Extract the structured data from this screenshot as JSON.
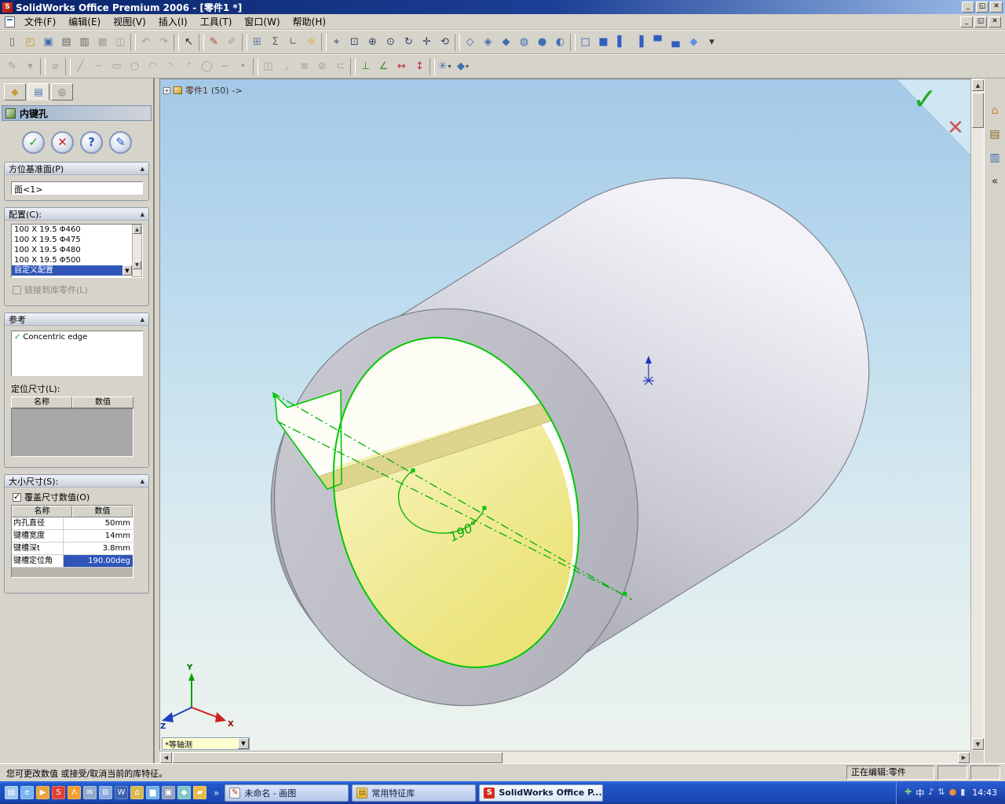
{
  "window": {
    "title": "SolidWorks Office Premium 2006 - [零件1 *]"
  },
  "titlebar_buttons": [
    {
      "name": "minimize-button",
      "glyph": "_"
    },
    {
      "name": "restore-button",
      "glyph": "◱"
    },
    {
      "name": "close-button",
      "glyph": "✕"
    }
  ],
  "menu": {
    "items": [
      "文件(F)",
      "编辑(E)",
      "视图(V)",
      "插入(I)",
      "工具(T)",
      "窗口(W)",
      "帮助(H)"
    ],
    "mdi_buttons": [
      {
        "name": "mdi-minimize-button",
        "glyph": "_"
      },
      {
        "name": "mdi-restore-button",
        "glyph": "◱"
      },
      {
        "name": "mdi-close-button",
        "glyph": "✕"
      }
    ]
  },
  "toolbars": {
    "main": [
      {
        "name": "new-button",
        "glyph": "▯",
        "color": "#666666",
        "enabled": true
      },
      {
        "name": "open-button",
        "glyph": "◰",
        "color": "#c79a2e",
        "enabled": true
      },
      {
        "name": "save-button",
        "glyph": "▣",
        "color": "#3f6fb0",
        "enabled": true
      },
      {
        "name": "make-drawing-button",
        "glyph": "▤",
        "color": "#666666",
        "enabled": true
      },
      {
        "name": "make-assembly-button",
        "glyph": "▥",
        "color": "#666666",
        "enabled": true
      },
      {
        "name": "print-button",
        "glyph": "▦",
        "color": "#999999",
        "enabled": false
      },
      {
        "name": "print-preview-button",
        "glyph": "◫",
        "color": "#999999",
        "enabled": false
      },
      {
        "sep": true
      },
      {
        "name": "undo-button",
        "glyph": "↶",
        "color": "#999999",
        "enabled": false
      },
      {
        "name": "redo-button",
        "glyph": "↷",
        "color": "#999999",
        "enabled": false
      },
      {
        "sep": true
      },
      {
        "name": "select-button",
        "glyph": "↖",
        "color": "#222222",
        "enabled": true
      },
      {
        "sep": true
      },
      {
        "name": "sketch-button",
        "glyph": "✎",
        "color": "#b2452c",
        "enabled": true
      },
      {
        "name": "3d-sketch-button",
        "glyph": "✐",
        "color": "#999999",
        "enabled": false
      },
      {
        "sep": true
      },
      {
        "name": "design-table-button",
        "glyph": "⊞",
        "color": "#5b79a5",
        "enabled": true
      },
      {
        "name": "equations-button",
        "glyph": "Σ",
        "color": "#666666",
        "enabled": true
      },
      {
        "name": "measure-button",
        "glyph": "∟",
        "color": "#666666",
        "enabled": true
      },
      {
        "name": "lighting-button",
        "glyph": "☼",
        "color": "#d8a400",
        "enabled": true
      },
      {
        "sep": true
      },
      {
        "name": "zoom-fit-button",
        "glyph": "⌖",
        "color": "#334466",
        "enabled": true
      },
      {
        "name": "zoom-area-button",
        "glyph": "⊡",
        "color": "#334466",
        "enabled": true
      },
      {
        "name": "zoom-in-out-button",
        "glyph": "⊕",
        "color": "#334466",
        "enabled": true
      },
      {
        "name": "zoom-selection-button",
        "glyph": "⊙",
        "color": "#334466",
        "enabled": true
      },
      {
        "name": "rotate-view-button",
        "glyph": "↻",
        "color": "#334466",
        "enabled": true
      },
      {
        "name": "pan-button",
        "glyph": "✛",
        "color": "#334466",
        "enabled": true
      },
      {
        "name": "previous-view-button",
        "glyph": "⟲",
        "color": "#334466",
        "enabled": true
      },
      {
        "sep": true
      },
      {
        "name": "wireframe-button",
        "glyph": "◇",
        "color": "#3f6fb0",
        "enabled": true
      },
      {
        "name": "hidden-lines-visible-button",
        "glyph": "◈",
        "color": "#3f6fb0",
        "enabled": true
      },
      {
        "name": "hidden-lines-removed-button",
        "glyph": "◆",
        "color": "#3f6fb0",
        "enabled": true
      },
      {
        "name": "shaded-with-edges-button",
        "glyph": "◍",
        "color": "#3f6fb0",
        "enabled": true
      },
      {
        "name": "shaded-button",
        "glyph": "●",
        "color": "#3f6fb0",
        "enabled": true
      },
      {
        "name": "section-view-button",
        "glyph": "◐",
        "color": "#3f6fb0",
        "enabled": true
      },
      {
        "sep": true
      },
      {
        "name": "front-view-button",
        "glyph": "□",
        "color": "#2f5fbf",
        "enabled": true
      },
      {
        "name": "back-view-button",
        "glyph": "■",
        "color": "#2f5fbf",
        "enabled": true
      },
      {
        "name": "left-view-button",
        "glyph": "▌",
        "color": "#2f5fbf",
        "enabled": true
      },
      {
        "name": "right-view-button",
        "glyph": "▐",
        "color": "#2f5fbf",
        "enabled": true
      },
      {
        "name": "top-view-button",
        "glyph": "▀",
        "color": "#2f5fbf",
        "enabled": true
      },
      {
        "name": "bottom-view-button",
        "glyph": "▄",
        "color": "#2f5fbf",
        "enabled": true
      },
      {
        "name": "isometric-view-button",
        "glyph": "◆",
        "color": "#5f8fdf",
        "enabled": true
      },
      {
        "name": "view-orientation-button",
        "glyph": "▾",
        "color": "#333333",
        "enabled": true
      }
    ],
    "sketch": [
      {
        "name": "sketch-tool-button",
        "glyph": "✎",
        "color": "#999999",
        "enabled": false
      },
      {
        "name": "sketch-flyout-button",
        "glyph": "▾",
        "color": "#999999",
        "enabled": false
      },
      {
        "sep": true
      },
      {
        "name": "smart-dimension-button",
        "glyph": "⌀",
        "color": "#999999",
        "enabled": false
      },
      {
        "sep": true
      },
      {
        "name": "line-button",
        "glyph": "╱",
        "color": "#999999",
        "enabled": false
      },
      {
        "name": "centerline-button",
        "glyph": "┄",
        "color": "#999999",
        "enabled": false
      },
      {
        "name": "rectangle-button",
        "glyph": "▭",
        "color": "#999999",
        "enabled": false
      },
      {
        "name": "circle-button",
        "glyph": "○",
        "color": "#999999",
        "enabled": false
      },
      {
        "name": "centerpoint-arc-button",
        "glyph": "◠",
        "color": "#999999",
        "enabled": false
      },
      {
        "name": "tangent-arc-button",
        "glyph": "◝",
        "color": "#999999",
        "enabled": false
      },
      {
        "name": "three-point-arc-button",
        "glyph": "◜",
        "color": "#999999",
        "enabled": false
      },
      {
        "name": "ellipse-button",
        "glyph": "◯",
        "color": "#999999",
        "enabled": false
      },
      {
        "name": "spline-button",
        "glyph": "∼",
        "color": "#999999",
        "enabled": false
      },
      {
        "name": "point-button",
        "glyph": "•",
        "color": "#999999",
        "enabled": false
      },
      {
        "sep": true
      },
      {
        "name": "mirror-entities-button",
        "glyph": "◫",
        "color": "#999999",
        "enabled": false
      },
      {
        "name": "sketch-fillet-button",
        "glyph": "◞",
        "color": "#999999",
        "enabled": false
      },
      {
        "name": "offset-entities-button",
        "glyph": "≡",
        "color": "#999999",
        "enabled": false
      },
      {
        "name": "trim-entities-button",
        "glyph": "⊘",
        "color": "#999999",
        "enabled": false
      },
      {
        "name": "convert-entities-button",
        "glyph": "⊂",
        "color": "#999999",
        "enabled": false
      },
      {
        "sep": true
      },
      {
        "name": "add-relation-button",
        "glyph": "⊥",
        "color": "#2e8b2e",
        "enabled": true
      },
      {
        "name": "display-relations-button",
        "glyph": "∠",
        "color": "#2e8b2e",
        "enabled": true
      },
      {
        "name": "horizontal-dimension-button",
        "glyph": "↔",
        "color": "#bb3333",
        "enabled": true
      },
      {
        "name": "vertical-dimension-button",
        "glyph": "↕",
        "color": "#bb3333",
        "enabled": true
      },
      {
        "sep": true
      },
      {
        "name": "library-feature-button",
        "glyph": "✳",
        "color": "#3f6fb0",
        "enabled": true,
        "dropdown": true
      },
      {
        "name": "block-button",
        "glyph": "◆",
        "color": "#3f6fb0",
        "enabled": true,
        "dropdown": true
      }
    ]
  },
  "property_manager": {
    "tabs": [
      {
        "name": "featuremanager-tab",
        "glyph": "◆",
        "color": "#c79a2e",
        "active": false
      },
      {
        "name": "propertymanager-tab",
        "glyph": "▤",
        "color": "#3f6fb0",
        "active": true
      },
      {
        "name": "configurationmanager-tab",
        "glyph": "◎",
        "color": "#6a6a6a",
        "active": false
      }
    ],
    "title": "内键孔",
    "actions": [
      {
        "name": "ok-button",
        "glyph": "✓",
        "color": "#1e9e1e"
      },
      {
        "name": "cancel-button",
        "glyph": "✕",
        "color": "#cc2222"
      },
      {
        "name": "help-button",
        "glyph": "?",
        "color": "#2255cc"
      },
      {
        "name": "preview-button",
        "glyph": "✎",
        "color": "#2255cc"
      }
    ],
    "orientation": {
      "header": "方位基准面(P)",
      "value": "面<1>"
    },
    "configuration": {
      "header": "配置(C):",
      "options": [
        "100 X 19.5 Φ460",
        "100 X 19.5 Φ475",
        "100 X 19.5 Φ480",
        "100 X 19.5 Φ500",
        "自定义配置"
      ],
      "selected_index": 4,
      "link_label": "链接到库零件(L)"
    },
    "reference": {
      "header": "参考",
      "item": "Concentric edge",
      "locating_label": "定位尺寸(L):",
      "columns": [
        "名称",
        "数值"
      ]
    },
    "size": {
      "header": "大小尺寸(S):",
      "override_label": "覆盖尺寸数值(O)",
      "columns": [
        "名称",
        "数值"
      ],
      "rows": [
        {
          "name": "内孔直径",
          "value": "50mm"
        },
        {
          "name": "键槽宽度",
          "value": "14mm"
        },
        {
          "name": "键槽深t",
          "value": "3.8mm"
        },
        {
          "name": "键槽定位角",
          "value": "190.00deg"
        }
      ],
      "selected_row": 3
    }
  },
  "viewport": {
    "tree": {
      "expand": "+",
      "part": "零件1",
      "dim": "(50)",
      "arrow": "->"
    },
    "angle_label": "190°",
    "view_combo": "*等轴测",
    "axes": {
      "x": "X",
      "y": "Y",
      "z": "Z"
    }
  },
  "taskpane": {
    "icons": [
      {
        "name": "solidworks-resources-icon",
        "glyph": "⌂",
        "color": "#c8822a"
      },
      {
        "name": "design-library-icon",
        "glyph": "▤",
        "color": "#8a6a20"
      },
      {
        "name": "file-explorer-icon",
        "glyph": "▥",
        "color": "#3f6fb0"
      },
      {
        "name": "collapse-taskpane-button",
        "glyph": "«",
        "color": "#333333"
      }
    ]
  },
  "status_bar": {
    "message": "您可更改数值 或接受/取消当前的库特征。",
    "editing": "正在编辑:零件"
  },
  "taskbar": {
    "quick_launch": [
      {
        "name": "quick-launch-desktop",
        "glyph": "▤",
        "color": "#9fc8f0"
      },
      {
        "name": "quick-launch-browser",
        "glyph": "e",
        "color": "#77b5f2"
      },
      {
        "name": "quick-launch-media",
        "glyph": "▶",
        "color": "#e8a33c"
      },
      {
        "name": "quick-launch-solidworks",
        "glyph": "S",
        "color": "#e04030"
      },
      {
        "name": "quick-launch-lambda",
        "glyph": "Λ",
        "color": "#f0a030"
      },
      {
        "name": "quick-launch-mail",
        "glyph": "✉",
        "color": "#8fa8cc"
      },
      {
        "name": "quick-launch-grid",
        "glyph": "⊞",
        "color": "#88aadd"
      },
      {
        "name": "quick-launch-word",
        "glyph": "W",
        "color": "#3a62b0"
      },
      {
        "name": "quick-launch-home",
        "glyph": "⌂",
        "color": "#d8b850"
      },
      {
        "name": "quick-launch-chart",
        "glyph": "▆",
        "color": "#6fb0e8"
      },
      {
        "name": "quick-launch-notes",
        "glyph": "▣",
        "color": "#90a0b8"
      },
      {
        "name": "quick-launch-tools",
        "glyph": "◆",
        "color": "#7ec8c8"
      },
      {
        "name": "quick-launch-folder",
        "glyph": "▰",
        "color": "#e8bc48"
      }
    ],
    "overflow_chevron": "»",
    "tasks": [
      {
        "name": "task-paint",
        "label": "未命名 - 画图",
        "icon": "paint",
        "active": false
      },
      {
        "name": "task-feature-library",
        "label": "常用特征库",
        "icon": "folder",
        "active": false
      },
      {
        "name": "task-solidworks",
        "label": "SolidWorks Office P...",
        "icon": "sw",
        "active": true
      }
    ],
    "tray": [
      {
        "name": "tray-antivirus-icon",
        "glyph": "✚",
        "color": "#7cd27c"
      },
      {
        "name": "tray-ime-icon",
        "glyph": "中",
        "color": "#ffffff"
      },
      {
        "name": "tray-volume-icon",
        "glyph": "♪",
        "color": "#e8eefc"
      },
      {
        "name": "tray-network-icon",
        "glyph": "⇅",
        "color": "#cfe0ff"
      },
      {
        "name": "tray-update-icon",
        "glyph": "●",
        "color": "#e89040"
      },
      {
        "name": "tray-device-icon",
        "glyph": "▮",
        "color": "#d8e0f0"
      }
    ],
    "time": "14:43"
  }
}
